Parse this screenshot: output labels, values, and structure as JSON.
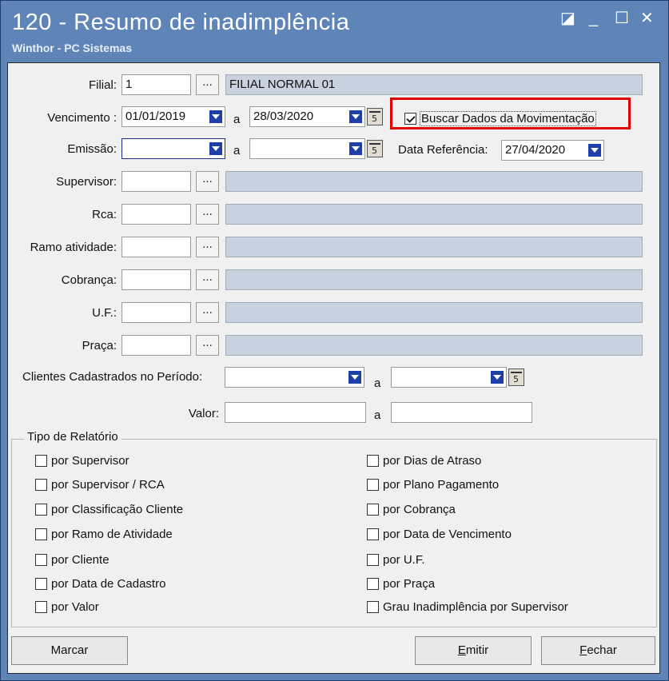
{
  "window": {
    "title": "120 - Resumo de inadimplência",
    "subtitle": "Winthor - PC Sistemas"
  },
  "form": {
    "filial": {
      "label": "Filial:",
      "code": "1",
      "desc": "FILIAL NORMAL 01"
    },
    "vencimento": {
      "label": "Vencimento :",
      "from": "01/01/2019",
      "sep": "a",
      "to": "28/03/2020"
    },
    "buscar": {
      "label": "Buscar Dados da Movimentação",
      "checked": true
    },
    "emissao": {
      "label": "Emissão:",
      "from": "",
      "sep": "a",
      "to": ""
    },
    "data_referencia": {
      "label": "Data Referência:",
      "value": "27/04/2020"
    },
    "supervisor": {
      "label": "Supervisor:"
    },
    "rca": {
      "label": "Rca:"
    },
    "ramo": {
      "label": "Ramo atividade:"
    },
    "cobranca": {
      "label": "Cobrança:"
    },
    "uf": {
      "label": "U.F.:"
    },
    "praca": {
      "label": "Praça:"
    },
    "clientes": {
      "label": "Clientes Cadastrados no Período:",
      "sep": "a"
    },
    "valor": {
      "label": "Valor:",
      "sep": "a"
    },
    "dots_label": "..."
  },
  "tipo_relatorio": {
    "title": "Tipo de Relatório",
    "left": [
      "por Supervisor",
      "por Supervisor / RCA",
      "por Classificação Cliente",
      "por Ramo de Atividade",
      "por Cliente",
      "por Data de Cadastro",
      "por Valor"
    ],
    "right": [
      "por Dias de Atraso",
      "por Plano Pagamento",
      "por Cobrança",
      "por Data de Vencimento",
      "por U.F.",
      "por Praça",
      "Grau Inadimplência por Supervisor"
    ]
  },
  "buttons": {
    "marcar": "Marcar",
    "emitir_first": "E",
    "emitir_rest": "mitir",
    "fechar_first": "F",
    "fechar_rest": "echar"
  },
  "colors": {
    "titlebar": "#5e84b8",
    "highlight": "#e00000",
    "dropdown_arrow": "#1c3fa8"
  }
}
